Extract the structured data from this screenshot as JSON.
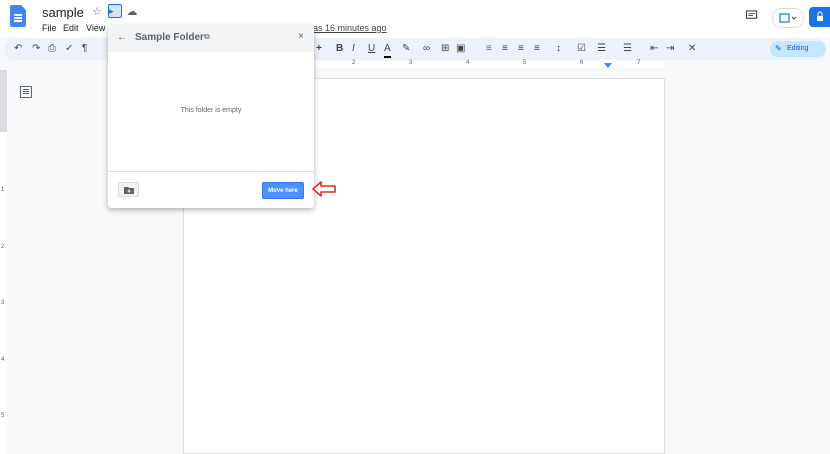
{
  "document": {
    "title": "sample",
    "last_edit": "as 16 minutes ago"
  },
  "menu": [
    "File",
    "Edit",
    "View"
  ],
  "toolbar": {
    "editing_label": "Editing",
    "bold_label": "B",
    "italic_label": "I",
    "underline_label": "U",
    "text_color_label": "A",
    "plus_label": "+"
  },
  "ruler": {
    "numbers": [
      "2",
      "3",
      "4",
      "5",
      "6",
      "7"
    ]
  },
  "vruler": {
    "numbers": [
      "1",
      "2",
      "3",
      "4",
      "5"
    ]
  },
  "dialog": {
    "folder_name": "Sample Folder",
    "empty_message": "This folder is empty",
    "move_here_label": "Move here"
  },
  "colors": {
    "accent": "#1a73e8",
    "move_here": "#4d90fe",
    "annotation_arrow": "#d93025"
  }
}
